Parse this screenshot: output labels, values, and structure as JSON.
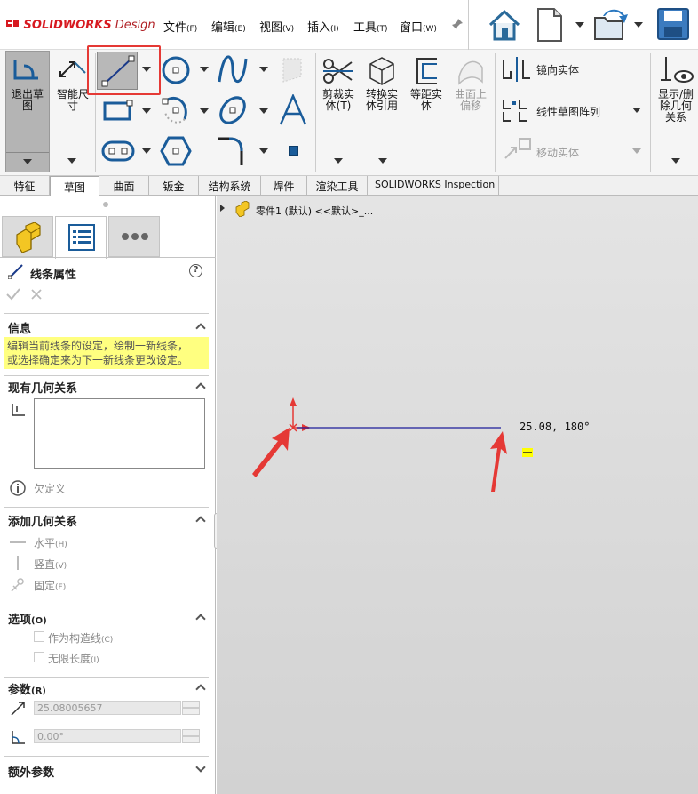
{
  "app": {
    "brand_prefix": "SOLID",
    "brand_suffix": "WORKS",
    "brand_design": "Design"
  },
  "menu": {
    "file": "文件",
    "file_key": "(F)",
    "edit": "编辑",
    "edit_key": "(E)",
    "view": "视图",
    "view_key": "(V)",
    "insert": "插入",
    "insert_key": "(I)",
    "tools": "工具",
    "tools_key": "(T)",
    "window": "窗口",
    "window_key": "(W)"
  },
  "ribbon": {
    "exit_sketch": [
      "退出草",
      "图"
    ],
    "smart_dim": [
      "智能尺",
      "寸"
    ],
    "trim": [
      "剪裁实",
      "体(T)"
    ],
    "convert": [
      "转换实",
      "体引用"
    ],
    "offset": [
      "等距实",
      "体"
    ],
    "surface_offset": [
      "曲面上",
      "偏移"
    ],
    "mirror": "镜向实体",
    "linear_pattern": "线性草图阵列",
    "move": "移动实体",
    "show_delete": [
      "显示/删",
      "除几何",
      "关系"
    ]
  },
  "tabs": [
    "特征",
    "草图",
    "曲面",
    "钣金",
    "结构系统",
    "焊件",
    "渲染工具",
    "SOLIDWORKS Inspection"
  ],
  "active_tab": "草图",
  "panel": {
    "title": "线条属性",
    "info_title": "信息",
    "info_text_1": "编辑当前线条的设定，绘制一新线条，",
    "info_text_2": "或选择确定来为下一新线条更改设定。",
    "existing_rel_title": "现有几何关系",
    "underdefined": "欠定义",
    "add_rel_title": "添加几何关系",
    "horizontal": "水平",
    "horizontal_key": "(H)",
    "vertical": "竖直",
    "vertical_key": "(V)",
    "fixed": "固定",
    "fixed_key": "(F)",
    "options_title": "选项",
    "options_key": "(O)",
    "construction": "作为构造线",
    "construction_key": "(C)",
    "infinite": "无限长度",
    "infinite_key": "(I)",
    "params_title": "参数",
    "params_key": "(R)",
    "length_value": "25.08005657",
    "angle_value": "0.00°",
    "extra_params_title": "额外参数"
  },
  "graphics": {
    "tree_label": "零件1 (默认) <<默认>_...",
    "dimension_readout": "25.08, 180°"
  },
  "colors": {
    "accent_red": "#e53935",
    "sketch_line": "#1c1c9a",
    "highlight_yellow": "#ffff80"
  }
}
